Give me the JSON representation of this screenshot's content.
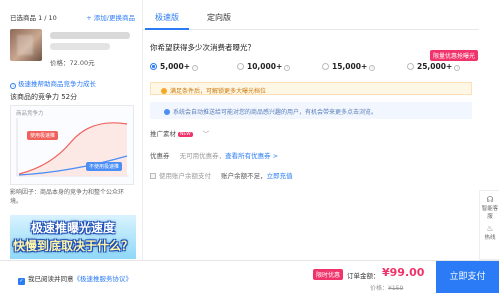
{
  "left": {
    "selected_label": "已选商品 1 / 10",
    "add_link": "+ 添加/更换商品",
    "product_price": "价格：72.00元",
    "hint": "极速推帮助商品竞争力成长",
    "rank_text": "该商品的竞争力 52分",
    "chart_caption": "商品竞争力",
    "chart_label_before": "使用极速推",
    "chart_label_after": "不使用极速推",
    "factor_text": "影响因子：商品本身的竞争力和整个公众环境。",
    "banner_line1": "极速推曝光速度",
    "banner_line2": "快慢到底取决于什么？"
  },
  "tabs": [
    {
      "label": "极速版",
      "active": true
    },
    {
      "label": "定向版",
      "active": false
    }
  ],
  "question": "你希望获得多少次消费者曝光？",
  "promo_badge": "限量优惠抢曝光",
  "options": [
    {
      "label": "5,000+",
      "selected": true
    },
    {
      "label": "10,000+",
      "selected": false
    },
    {
      "label": "15,000+",
      "selected": false
    },
    {
      "label": "25,000+",
      "selected": false
    }
  ],
  "warning": "满足条件后，可解锁更多大曝光档位",
  "info": "系统会自动推送给可能对您的商品感兴趣的用户，有机会带来更多点击浏览。",
  "promo_material": {
    "label": "推广素材",
    "badge": "NEW"
  },
  "coupon": {
    "label": "优惠券",
    "value": "无可用优惠券，",
    "link": "查看所有优惠券 >"
  },
  "balance": {
    "label": "使用账户余额支付",
    "value": "账户余额不足，",
    "link": "立即充值"
  },
  "side_tools": [
    {
      "icon": "headset-icon",
      "label": "智能客服"
    },
    {
      "icon": "fire-icon",
      "label": "热线"
    }
  ],
  "bottom": {
    "agree_text": "我已阅读并同意",
    "agree_link": "《极速推服务协议》",
    "limited_badge": "限时优惠",
    "total_label": "订单金额：",
    "total": "¥99.00",
    "orig_label": "价格：",
    "orig_price": "¥159",
    "pay_label": "立即支付"
  }
}
